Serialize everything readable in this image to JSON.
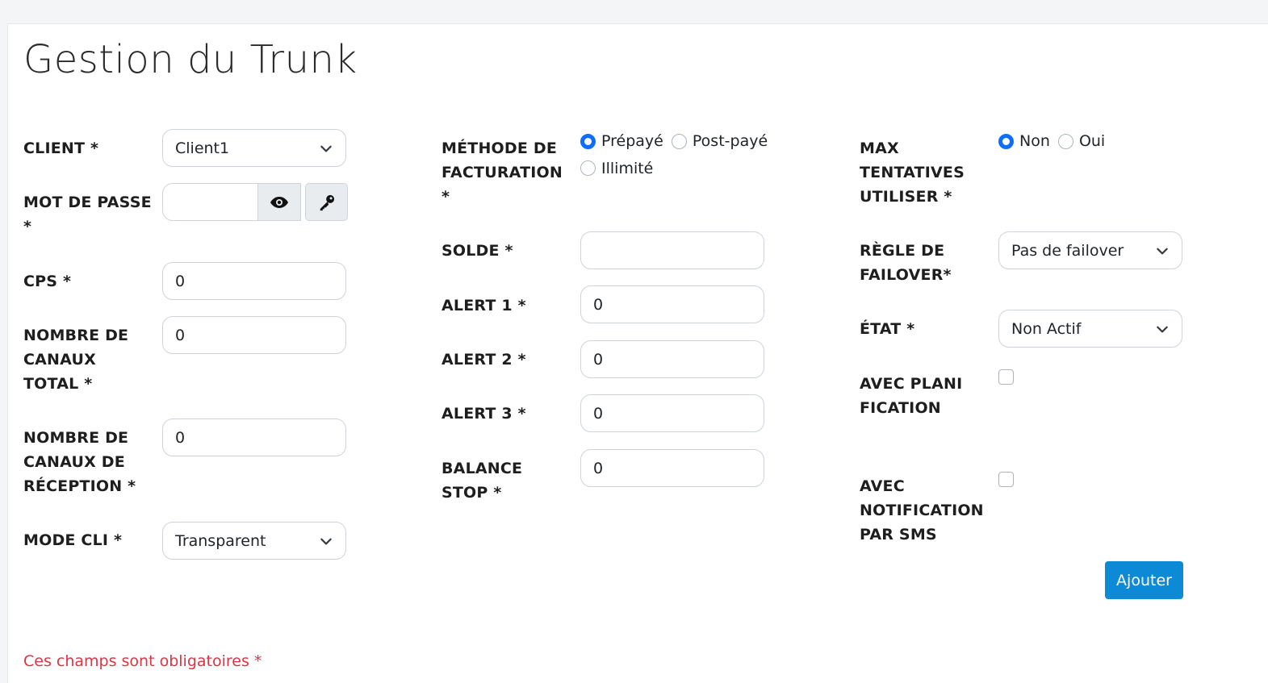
{
  "page_title": "Gestion du Trunk",
  "col1": {
    "client_label": "CLIENT *",
    "client_value": "Client1",
    "password_label": "MOT DE PASSE *",
    "cps_label": "CPS *",
    "cps_value": "0",
    "total_channels_label": "NOMBRE DE CANAUX TOTAL *",
    "total_channels_value": "0",
    "reception_channels_label": "NOMBRE DE CANAUX DE RÉCEPTION *",
    "reception_channels_value": "0",
    "cli_mode_label": "MODE CLI *",
    "cli_mode_value": "Transparent"
  },
  "col2": {
    "billing_label": "MÉTHODE DE FACTURATION *",
    "billing_options": [
      {
        "label": "Prépayé",
        "checked": true
      },
      {
        "label": "Post-payé",
        "checked": false
      },
      {
        "label": "Illimité",
        "checked": false
      }
    ],
    "balance_label": "SOLDE *",
    "balance_value": "",
    "alert1_label": "ALERT 1 *",
    "alert1_value": "0",
    "alert2_label": "ALERT 2 *",
    "alert2_value": "0",
    "alert3_label": "ALERT 3 *",
    "alert3_value": "0",
    "balance_stop_label": "BALANCE STOP *",
    "balance_stop_value": "0"
  },
  "col3": {
    "max_attempts_label": "MAX TENTATIVES UTILISER *",
    "max_attempts_options": [
      {
        "label": "Non",
        "checked": true
      },
      {
        "label": "Oui",
        "checked": false
      }
    ],
    "failover_label": "RÈGLE DE FAILOVER*",
    "failover_value": "Pas de failover",
    "state_label": "ÉTAT *",
    "state_value": "Non Actif",
    "planning_label": "AVEC PLANIFICATION",
    "planning_checked": false,
    "sms_label": "AVEC NOTIFICATION PAR SMS",
    "sms_checked": false,
    "add_button": "Ajouter"
  },
  "footer_note": "Ces champs sont obligatoires *",
  "colors": {
    "primary_radio": "#0d6efd",
    "button": "#0d8ad6",
    "required_note": "#dc3545"
  },
  "icons": [
    "eye-icon",
    "key-icon",
    "chevron-down-icon"
  ]
}
